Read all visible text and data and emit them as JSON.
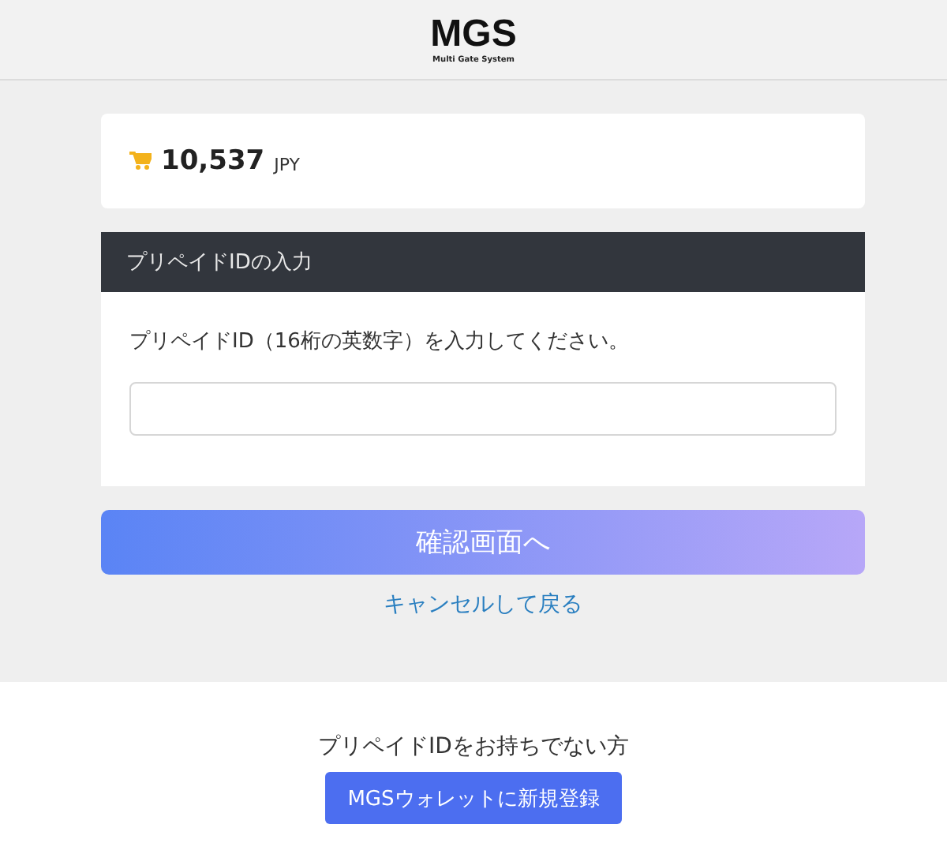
{
  "header": {
    "logo": "MGS",
    "tagline": "Multi Gate System"
  },
  "balance": {
    "amount": "10,537",
    "currency": "JPY"
  },
  "form": {
    "title": "プリペイドIDの入力",
    "instruction": "プリペイドID（16桁の英数字）を入力してください。"
  },
  "confirm_button": "確認画面へ",
  "cancel_link": "キャンセルして戻る",
  "footer": {
    "text": "プリペイドIDをお持ちでない方",
    "register_button": "MGSウォレットに新規登録"
  }
}
